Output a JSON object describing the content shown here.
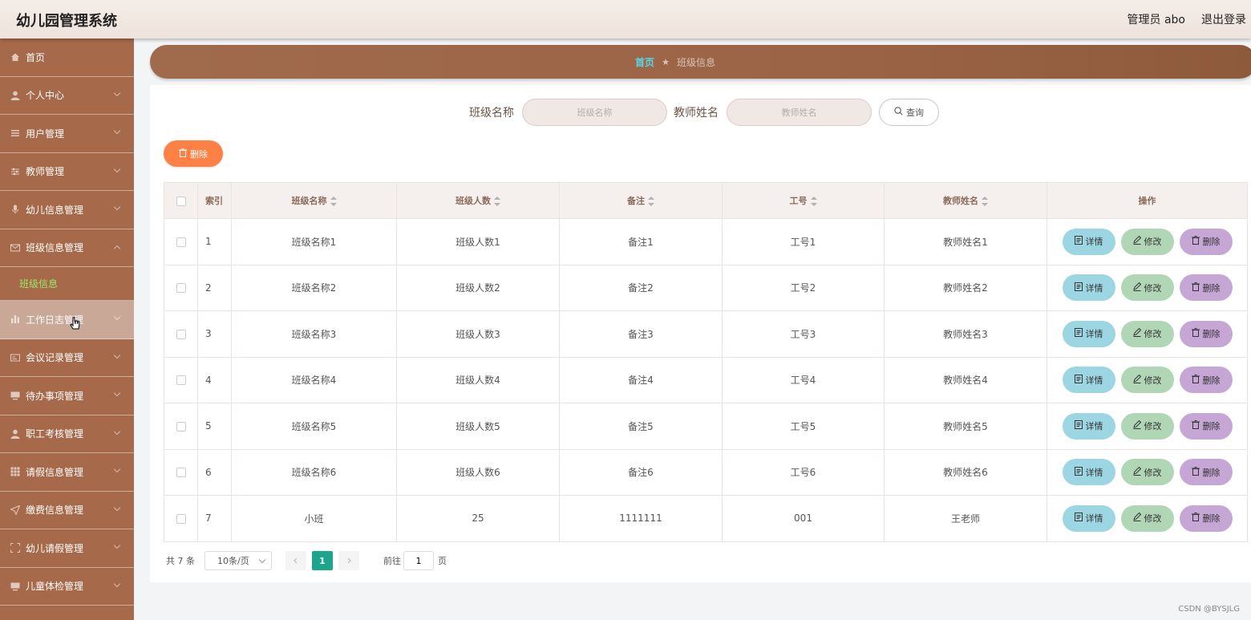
{
  "header": {
    "title": "幼儿园管理系统",
    "user": "管理员 abo",
    "logout": "退出登录"
  },
  "sidebar": {
    "items": [
      {
        "label": "首页",
        "icon": "home-icon"
      },
      {
        "label": "个人中心",
        "icon": "user-icon"
      },
      {
        "label": "用户管理",
        "icon": "list-icon"
      },
      {
        "label": "教师管理",
        "icon": "sliders-icon"
      },
      {
        "label": "幼儿信息管理",
        "icon": "microphone-icon"
      },
      {
        "label": "班级信息管理",
        "icon": "envelope-icon",
        "expanded": true
      },
      {
        "label": "工作日志管理",
        "icon": "bar-chart-icon",
        "hover": true
      },
      {
        "label": "会议记录管理",
        "icon": "card-icon"
      },
      {
        "label": "待办事项管理",
        "icon": "monitor-icon"
      },
      {
        "label": "职工考核管理",
        "icon": "user-icon"
      },
      {
        "label": "请假信息管理",
        "icon": "grid-icon"
      },
      {
        "label": "缴费信息管理",
        "icon": "send-icon"
      },
      {
        "label": "幼儿请假管理",
        "icon": "frame-icon"
      },
      {
        "label": "儿童体检管理",
        "icon": "monitor-icon"
      }
    ],
    "submenu": {
      "label": "班级信息"
    },
    "active_color": "#9ee66b"
  },
  "breadcrumb": {
    "home": "首页",
    "sep": "★",
    "current": "班级信息"
  },
  "search": {
    "class_label": "班级名称",
    "class_placeholder": "班级名称",
    "teacher_label": "教师姓名",
    "teacher_placeholder": "教师姓名",
    "query_label": "查询"
  },
  "toolbar": {
    "delete_label": "删除"
  },
  "table": {
    "headers": {
      "index": "索引",
      "class_name": "班级名称",
      "count": "班级人数",
      "note": "备注",
      "job_no": "工号",
      "teacher": "教师姓名",
      "ops": "操作"
    },
    "rows": [
      {
        "index": "1",
        "class_name": "班级名称1",
        "count": "班级人数1",
        "note": "备注1",
        "job_no": "工号1",
        "teacher": "教师姓名1"
      },
      {
        "index": "2",
        "class_name": "班级名称2",
        "count": "班级人数2",
        "note": "备注2",
        "job_no": "工号2",
        "teacher": "教师姓名2"
      },
      {
        "index": "3",
        "class_name": "班级名称3",
        "count": "班级人数3",
        "note": "备注3",
        "job_no": "工号3",
        "teacher": "教师姓名3"
      },
      {
        "index": "4",
        "class_name": "班级名称4",
        "count": "班级人数4",
        "note": "备注4",
        "job_no": "工号4",
        "teacher": "教师姓名4"
      },
      {
        "index": "5",
        "class_name": "班级名称5",
        "count": "班级人数5",
        "note": "备注5",
        "job_no": "工号5",
        "teacher": "教师姓名5"
      },
      {
        "index": "6",
        "class_name": "班级名称6",
        "count": "班级人数6",
        "note": "备注6",
        "job_no": "工号6",
        "teacher": "教师姓名6"
      },
      {
        "index": "7",
        "class_name": "小班",
        "count": "25",
        "note": "1111111",
        "job_no": "001",
        "teacher": "王老师"
      }
    ],
    "actions": {
      "detail": "详情",
      "edit": "修改",
      "delete": "删除"
    }
  },
  "pagination": {
    "total": "共 7 条",
    "page_size": "10条/页",
    "current_page": "1",
    "goto_prefix": "前往",
    "goto_value": "1",
    "goto_suffix": "页"
  },
  "watermark": "CSDN @BYSJLG",
  "colors": {
    "sidebar": "#a6694a",
    "delete_orange": "#fd8044",
    "detail": "#9cd6e2",
    "edit": "#b1d6b6",
    "remove": "#c5a6d5",
    "page_active": "#1aa58c",
    "crumb_home": "#5ad7e6"
  }
}
